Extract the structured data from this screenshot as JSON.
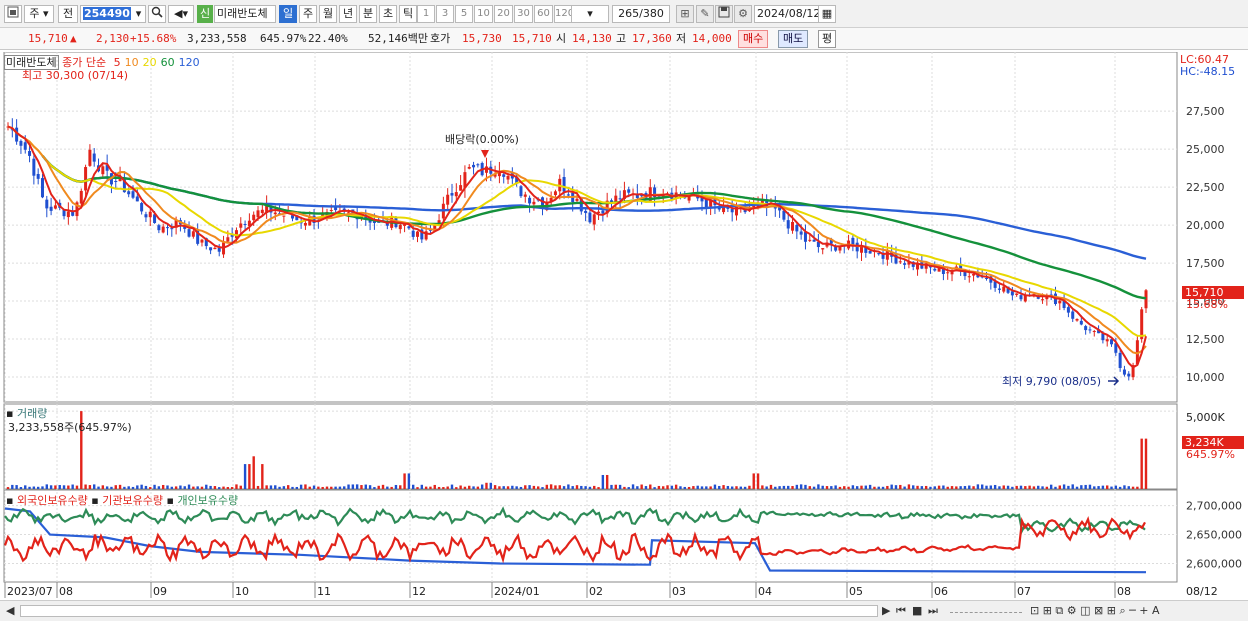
{
  "toolbar": {
    "period_type": "주",
    "full_label": "전",
    "code_value": "254490",
    "stock_badge": "신",
    "stock_name": "미래반도체",
    "periods": [
      "일",
      "주",
      "월",
      "년",
      "분",
      "초",
      "틱"
    ],
    "active_period": "일",
    "intervals": [
      "1",
      "3",
      "5",
      "10",
      "20",
      "30",
      "60",
      "120"
    ],
    "count_display": "265",
    "count_total": "/380",
    "date_value": "2024/08/12"
  },
  "infobar": {
    "price": "15,710",
    "change": "2,130",
    "change_pct": "+15.68%",
    "volume": "3,233,558",
    "volume_pct": "645.97%",
    "turnover_pct": "22.40%",
    "amount": "52,146백만",
    "quote_label": "호가",
    "ask": "15,730",
    "bid": "15,710",
    "open_label": "시",
    "open": "14,130",
    "high_label": "고",
    "high": "17,360",
    "low_label": "저",
    "low": "14,000",
    "buy_label": "매수",
    "sell_label": "매도",
    "avg_label": "평"
  },
  "price_panel": {
    "stock_name": "미래반도체",
    "ma_label": "종가 단순",
    "ma_periods": [
      {
        "label": "5",
        "color": "#e2231a"
      },
      {
        "label": "10",
        "color": "#f08a1f"
      },
      {
        "label": "20",
        "color": "#e8d800"
      },
      {
        "label": "60",
        "color": "#14913b"
      },
      {
        "label": "120",
        "color": "#2a5fd6"
      }
    ],
    "high_note": "최고 30,300 (07/14)",
    "low_note": "최저 9,790 (08/05)",
    "dividend_note": "배당락(0.00%)",
    "lc": "LC:60.47",
    "hc": "HC:-48.15",
    "current_price": "15,710",
    "current_pct": "15.68%",
    "y_ticks": [
      "27,500",
      "25,000",
      "22,500",
      "20,000",
      "17,500",
      "15,000",
      "12,500",
      "10,000"
    ]
  },
  "volume_panel": {
    "title": "거래량",
    "value": "3,233,558주(645.97%)",
    "y_tick": "5,000K",
    "current": "3,234K",
    "current_pct": "645.97%"
  },
  "holding_panel": {
    "legend": [
      "외국인보유수량",
      "기관보유수량",
      "개인보유수량"
    ],
    "y_ticks": [
      "2,700,000",
      "2,650,000",
      "2,600,000"
    ]
  },
  "x_axis": {
    "labels": [
      "2023/07",
      "08",
      "09",
      "10",
      "11",
      "12",
      "2024/01",
      "02",
      "03",
      "04",
      "05",
      "06",
      "07",
      "08"
    ],
    "right_label": "08/12"
  },
  "colors": {
    "up": "#e2231a",
    "down": "#1f4fd0",
    "ma5": "#e2231a",
    "ma10": "#f08a1f",
    "ma20": "#e8d800",
    "ma60": "#14913b",
    "ma120": "#2a5fd6",
    "foreign": "#e2231a",
    "institution": "#2a5fd6",
    "individual": "#2e8b57"
  },
  "icons": [
    "chart-type-icon",
    "search-icon",
    "speaker-icon",
    "wrench-icon",
    "save-icon",
    "gear-icon",
    "calendar-icon"
  ]
}
